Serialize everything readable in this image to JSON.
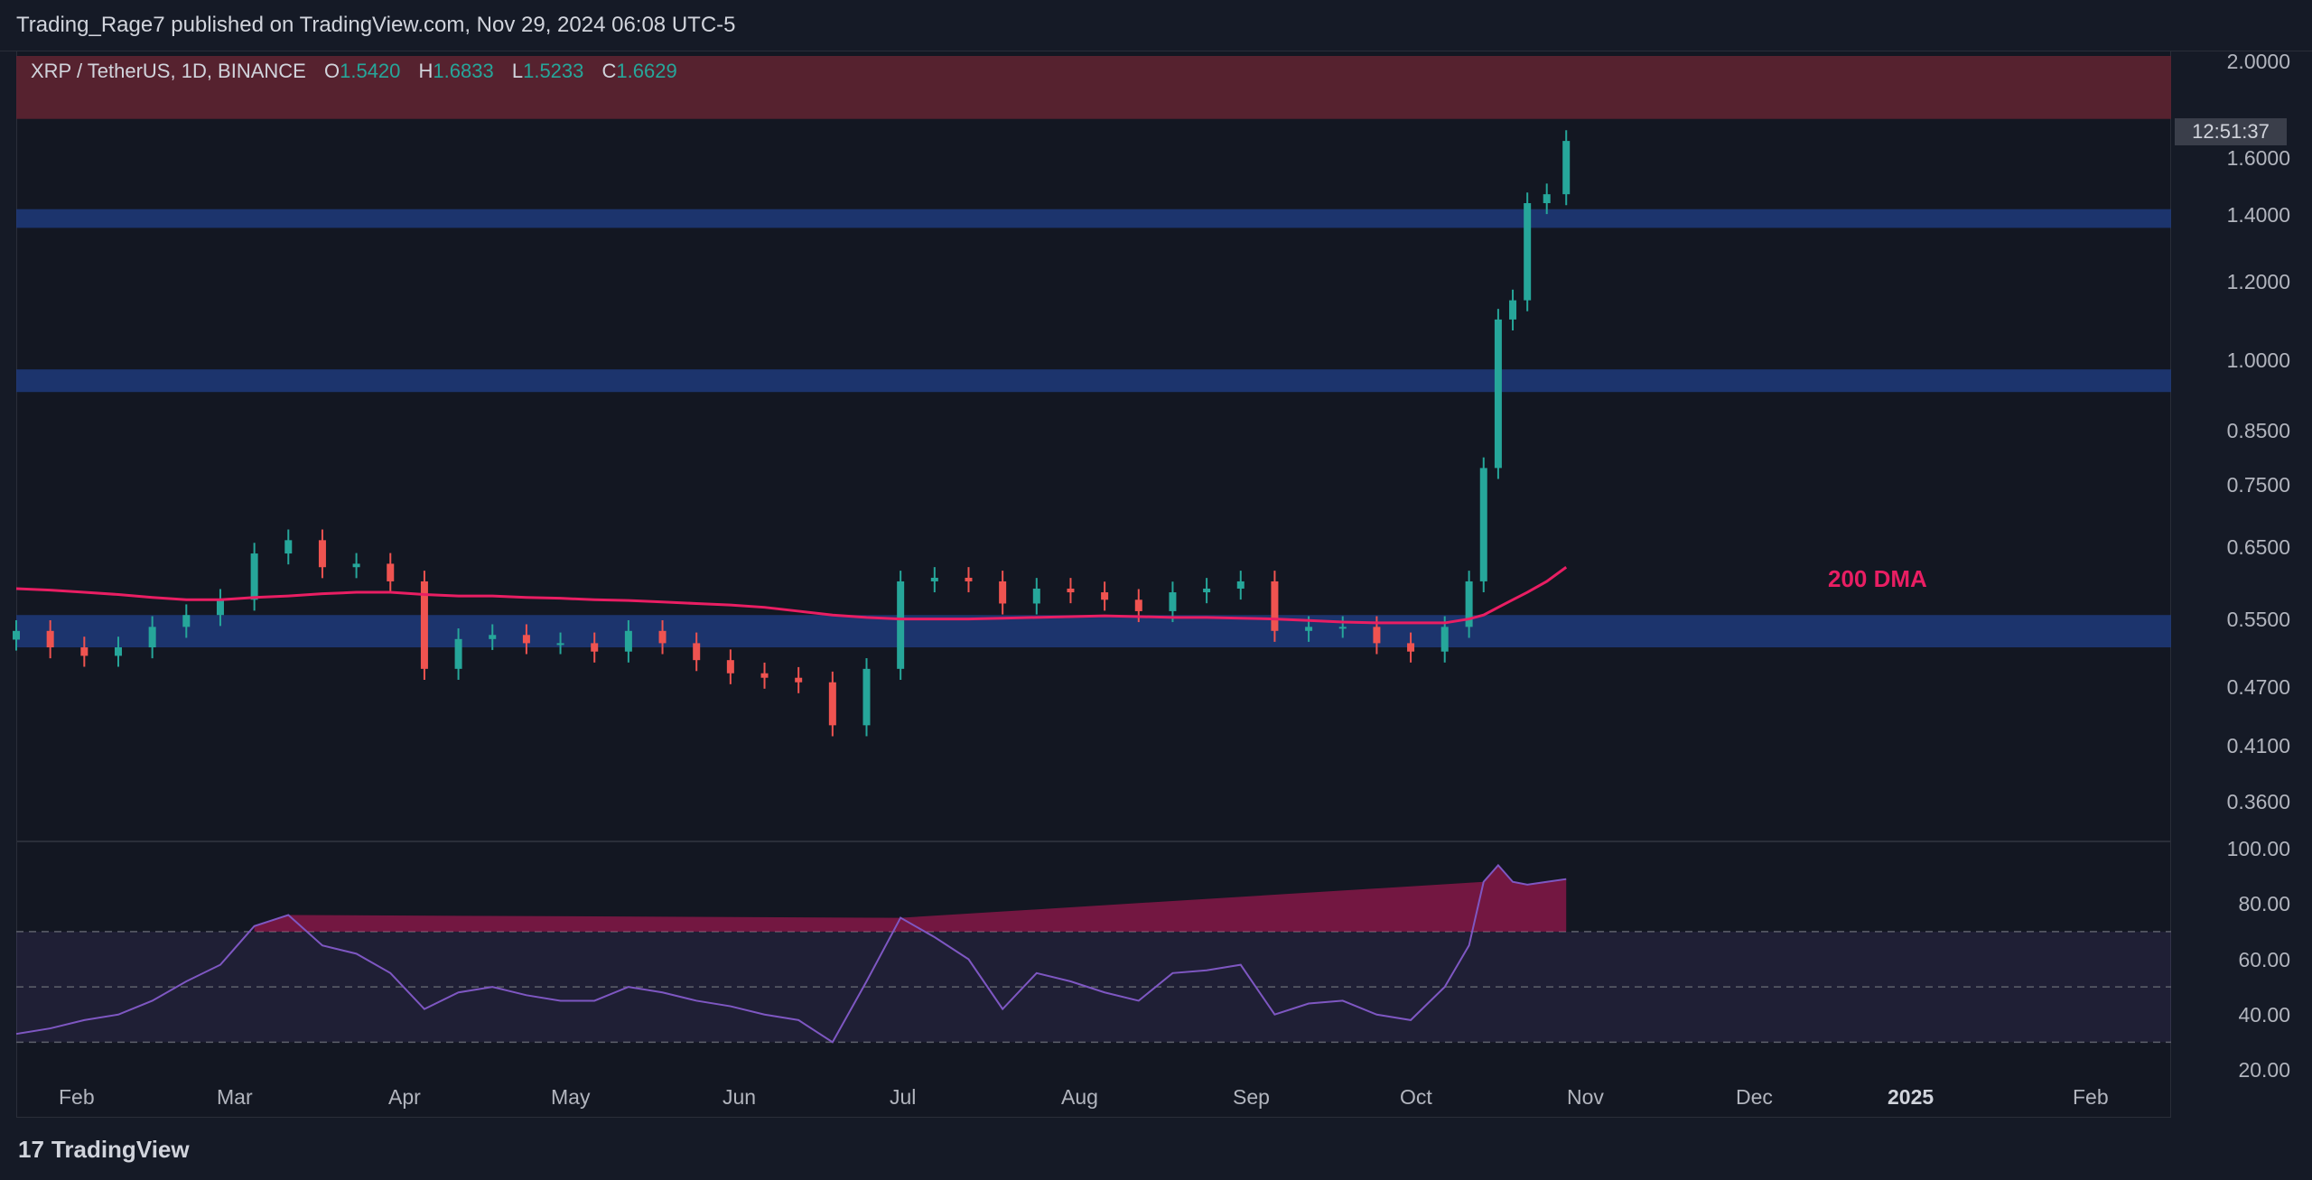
{
  "header": {
    "publisher_line": "Trading_Rage7 published on TradingView.com, Nov 29, 2024 06:08 UTC-5"
  },
  "legend": {
    "symbol": "XRP / TetherUS, 1D, BINANCE",
    "open_label": "O",
    "open": "1.5420",
    "high_label": "H",
    "high": "1.6833",
    "low_label": "L",
    "low": "1.5233",
    "close_label": "C",
    "close": "1.6629"
  },
  "countdown": "12:51:37",
  "annotation": "200 DMA",
  "footer": {
    "brand": "TradingView",
    "brand_mark": "17"
  },
  "colors": {
    "up": "#26a69a",
    "down": "#ef5350",
    "dma": "#e91e63",
    "zone": "#1f3a7a",
    "top_zone": "#5a2330",
    "rsi": "#7e57c2"
  },
  "chart_data": [
    {
      "type": "candlestick",
      "title": "XRP / TetherUS, 1D, BINANCE",
      "y_scale": "log",
      "ylim": [
        0.33,
        2.05
      ],
      "price_ticks": [
        "2.0000",
        "1.6000",
        "1.4000",
        "1.2000",
        "1.0000",
        "0.8500",
        "0.7500",
        "0.6500",
        "0.5500",
        "0.4700",
        "0.4100",
        "0.3600"
      ],
      "x_ticks": [
        "Feb",
        "Mar",
        "Apr",
        "May",
        "Jun",
        "Jul",
        "Aug",
        "Sep",
        "Oct",
        "Nov",
        "Dec",
        "2025",
        "Feb"
      ],
      "x": [
        "2024-01-15",
        "2024-01-22",
        "2024-01-29",
        "2024-02-05",
        "2024-02-12",
        "2024-02-19",
        "2024-02-26",
        "2024-03-04",
        "2024-03-11",
        "2024-03-18",
        "2024-03-25",
        "2024-04-01",
        "2024-04-08",
        "2024-04-15",
        "2024-04-22",
        "2024-04-29",
        "2024-05-06",
        "2024-05-13",
        "2024-05-20",
        "2024-05-27",
        "2024-06-03",
        "2024-06-10",
        "2024-06-17",
        "2024-06-24",
        "2024-07-01",
        "2024-07-08",
        "2024-07-15",
        "2024-07-22",
        "2024-07-29",
        "2024-08-05",
        "2024-08-12",
        "2024-08-19",
        "2024-08-26",
        "2024-09-02",
        "2024-09-09",
        "2024-09-16",
        "2024-09-23",
        "2024-09-30",
        "2024-10-07",
        "2024-10-14",
        "2024-10-21",
        "2024-10-28",
        "2024-11-04",
        "2024-11-09",
        "2024-11-12",
        "2024-11-15",
        "2024-11-18",
        "2024-11-21",
        "2024-11-25",
        "2024-11-29"
      ],
      "close": [
        0.535,
        0.515,
        0.505,
        0.515,
        0.54,
        0.555,
        0.575,
        0.64,
        0.66,
        0.62,
        0.625,
        0.6,
        0.49,
        0.525,
        0.53,
        0.52,
        0.52,
        0.51,
        0.535,
        0.52,
        0.5,
        0.485,
        0.48,
        0.475,
        0.43,
        0.49,
        0.6,
        0.605,
        0.6,
        0.57,
        0.59,
        0.585,
        0.575,
        0.56,
        0.585,
        0.59,
        0.6,
        0.535,
        0.54,
        0.54,
        0.52,
        0.51,
        0.54,
        0.6,
        0.78,
        1.1,
        1.15,
        1.44,
        1.47,
        1.663
      ],
      "ma200": [
        0.59,
        0.588,
        0.585,
        0.582,
        0.578,
        0.575,
        0.575,
        0.578,
        0.58,
        0.583,
        0.585,
        0.585,
        0.582,
        0.58,
        0.58,
        0.578,
        0.577,
        0.575,
        0.574,
        0.572,
        0.57,
        0.568,
        0.565,
        0.56,
        0.555,
        0.552,
        0.55,
        0.55,
        0.55,
        0.551,
        0.552,
        0.553,
        0.554,
        0.553,
        0.552,
        0.552,
        0.551,
        0.55,
        0.548,
        0.546,
        0.545,
        0.545,
        0.545,
        0.55,
        0.555,
        0.565,
        0.575,
        0.585,
        0.6,
        0.62
      ],
      "zones": [
        [
          0.515,
          0.555
        ],
        [
          0.93,
          0.98
        ],
        [
          1.36,
          1.42
        ],
        [
          1.75,
          2.0
        ]
      ]
    },
    {
      "type": "line",
      "title": "RSI",
      "ylim": [
        20,
        100
      ],
      "y_ticks": [
        "100.00",
        "80.00",
        "60.00",
        "40.00",
        "20.00"
      ],
      "band": [
        30,
        70
      ],
      "values": [
        33,
        35,
        38,
        40,
        45,
        52,
        58,
        72,
        76,
        65,
        62,
        55,
        42,
        48,
        50,
        47,
        45,
        45,
        50,
        48,
        45,
        43,
        40,
        38,
        30,
        52,
        75,
        68,
        60,
        42,
        55,
        52,
        48,
        45,
        55,
        56,
        58,
        40,
        44,
        45,
        40,
        38,
        50,
        65,
        88,
        94,
        88,
        87,
        88,
        89
      ]
    }
  ]
}
